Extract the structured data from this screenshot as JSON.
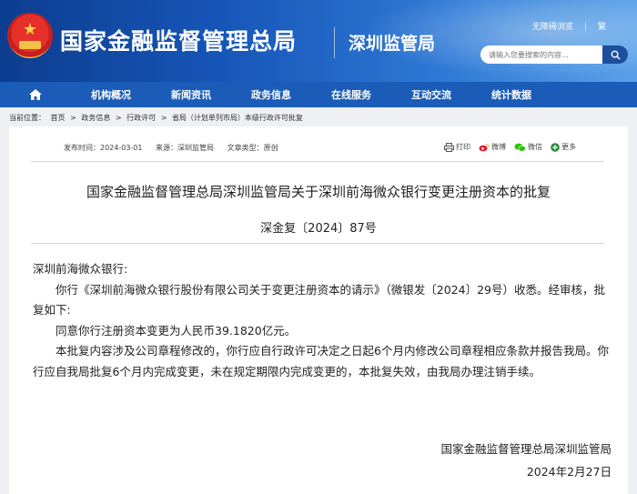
{
  "header": {
    "site_title": "国家金融监督管理总局",
    "sub_title": "深圳监管局",
    "top_links": [
      "无障碍浏览",
      "繁"
    ],
    "search_placeholder": "请输入您要搜索的内容...",
    "colors": {
      "header_start": "#0d3d8f",
      "header_end": "#58a0e8",
      "nav_bg": "#1a5cb8",
      "emblem_red": "#e6312a",
      "emblem_gold": "#f1c24a"
    }
  },
  "nav": {
    "home_icon": "home-icon",
    "items": [
      "机构概况",
      "新闻资讯",
      "政务信息",
      "在线服务",
      "互动交流",
      "统计数据"
    ]
  },
  "breadcrumb": {
    "label": "当前位置：",
    "items": [
      "首页",
      "政务信息",
      "行政许可",
      "省局（计划单列市局）本级行政许可批复"
    ],
    "separator": ">"
  },
  "meta": {
    "publish_time": "发布时间：2024-03-01",
    "source": "来源：深圳监管局",
    "doc_type": "文章类型：原创"
  },
  "share": {
    "print": "打印",
    "weibo": "微博",
    "wechat": "微信",
    "more": "更多"
  },
  "article": {
    "title": "国家金融监督管理总局深圳监管局关于深圳前海微众银行变更注册资本的批复",
    "doc_number": "深金复〔2024〕87号",
    "salutation": "深圳前海微众银行:",
    "p1": "你行《深圳前海微众银行股份有限公司关于变更注册资本的请示》（微银发〔2024〕29号）收悉。经审核，批复如下:",
    "p2": "同意你行注册资本变更为人民币39.1820亿元。",
    "p3": "本批复内容涉及公司章程修改的，你行应自行政许可决定之日起6个月内修改公司章程相应条款并报告我局。你行应自我局批复6个月内完成变更，未在规定期限内完成变更的，本批复失效，由我局办理注销手续。",
    "signer": "国家金融监督管理总局深圳监管局",
    "date": "2024年2月27日"
  }
}
